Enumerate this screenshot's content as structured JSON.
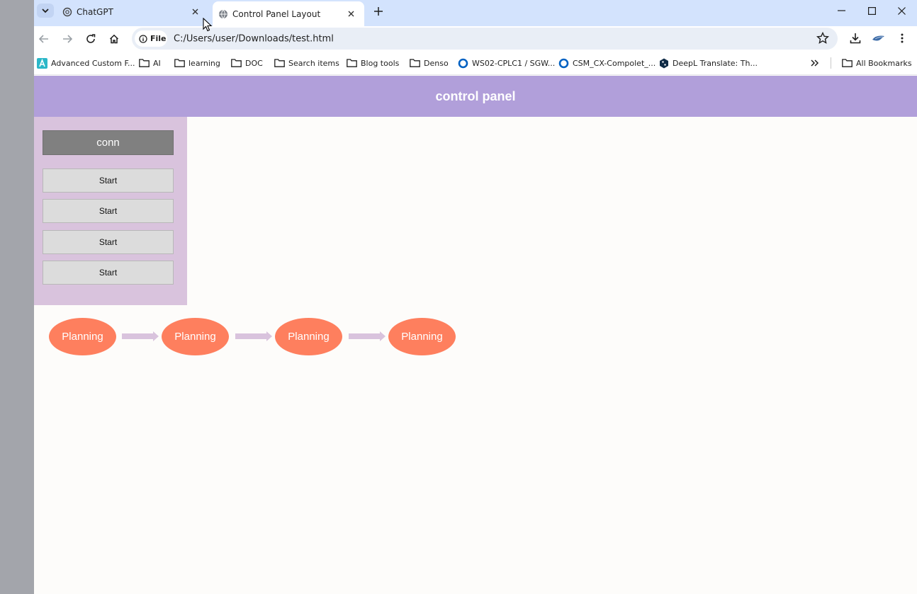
{
  "browser": {
    "tabs": [
      {
        "title": "ChatGPT",
        "active": false,
        "icon": "chatgpt-icon"
      },
      {
        "title": "Control Panel Layout",
        "active": true,
        "icon": "globe-icon"
      }
    ],
    "site_chip": "File",
    "url": "C:/Users/user/Downloads/test.html",
    "bookmarks": [
      {
        "label": "Advanced Custom F...",
        "icon": "acf-icon"
      },
      {
        "label": "AI",
        "icon": "folder-icon"
      },
      {
        "label": "learning",
        "icon": "folder-icon"
      },
      {
        "label": "DOC",
        "icon": "folder-icon"
      },
      {
        "label": "Search items",
        "icon": "folder-icon"
      },
      {
        "label": "Blog tools",
        "icon": "folder-icon"
      },
      {
        "label": "Denso",
        "icon": "folder-icon"
      },
      {
        "label": "WS02-CPLC1 / SGW...",
        "icon": "ring-icon"
      },
      {
        "label": "CSM_CX-Compolet_...",
        "icon": "ring-icon"
      },
      {
        "label": "DeepL Translate: Th...",
        "icon": "deepl-icon"
      }
    ],
    "all_bookmarks": "All Bookmarks",
    "colors": {
      "tabstrip": "#d3e3fd",
      "omnibox": "#e9eef6"
    }
  },
  "page": {
    "header_title": "control panel",
    "conn_label": "conn",
    "start_buttons": [
      "Start",
      "Start",
      "Start",
      "Start"
    ],
    "flow_nodes": [
      "Planning",
      "Planning",
      "Planning",
      "Planning"
    ],
    "colors": {
      "header": "#b19fda",
      "panel": "#d9c3dd",
      "node": "#fe7f5e",
      "arrow": "#d9c3dd",
      "conn": "#808080"
    }
  }
}
